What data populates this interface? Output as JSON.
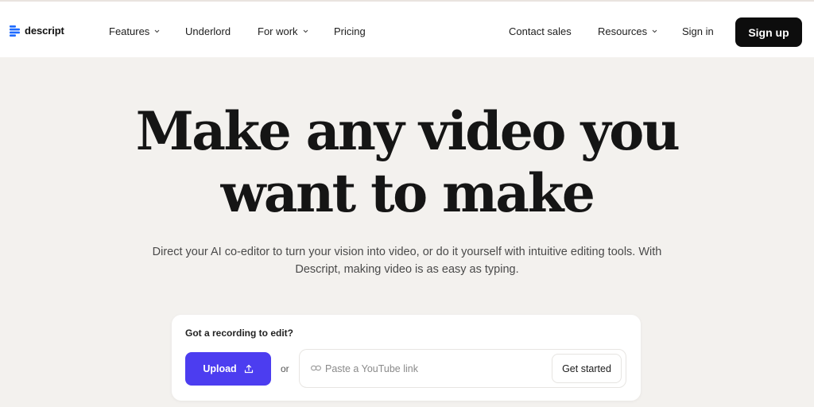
{
  "brand": {
    "name": "descript",
    "icon": "descript-logo-icon",
    "color": "#1f6bff"
  },
  "nav": {
    "features": "Features",
    "underlord": "Underlord",
    "for_work": "For work",
    "pricing": "Pricing",
    "contact_sales": "Contact sales",
    "resources": "Resources",
    "sign_in": "Sign in",
    "sign_up": "Sign up"
  },
  "hero": {
    "title_line1": "Make any video you",
    "title_line2": "want to make",
    "subtitle_line1": "Direct your AI co-editor to turn your vision into video, or do it yourself with intuitive editing tools. With",
    "subtitle_line2": "Descript, making video is as easy as typing."
  },
  "upload_card": {
    "title": "Got a recording to edit?",
    "upload_label": "Upload",
    "or_label": "or",
    "youtube_placeholder": "Paste a YouTube link",
    "youtube_value": "",
    "get_started_label": "Get started"
  },
  "colors": {
    "accent": "#4c3df0",
    "signup_bg": "#0d0d0d",
    "page_bg": "#f3f1ee"
  }
}
